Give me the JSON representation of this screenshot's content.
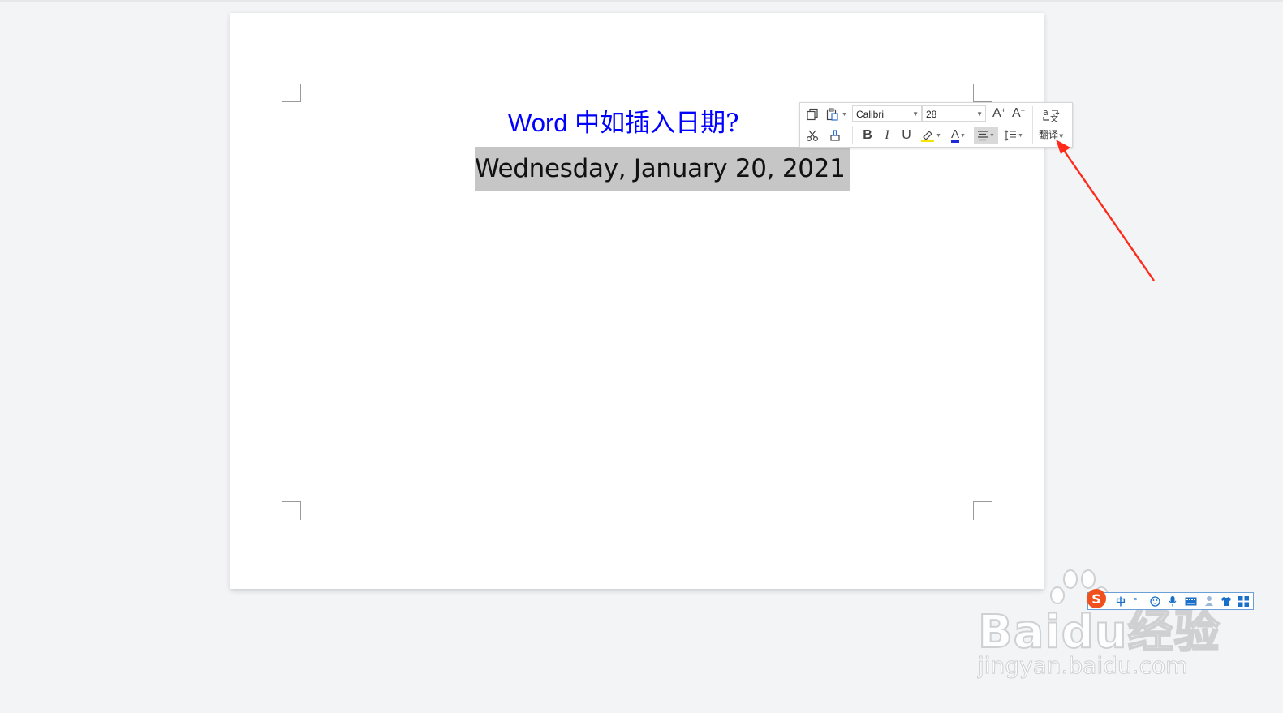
{
  "document": {
    "title_latin": "Word ",
    "title_cjk": "中如插入日期?",
    "date_text": "Wednesday, January 20, 2021"
  },
  "mini_toolbar": {
    "font_name": "Calibri",
    "font_size": "28",
    "grow_font_label": "A",
    "shrink_font_label": "A",
    "bold_label": "B",
    "italic_label": "I",
    "underline_label": "U",
    "font_color_label": "A",
    "translate_label": "翻译",
    "highlight_color": "#f5e600",
    "font_color": "#1f2bd8"
  },
  "ime_bar": {
    "logo_label": "S",
    "mode_label": "中"
  },
  "watermark": {
    "main": "Baidu经验",
    "sub": "jingyan.baidu.com"
  },
  "colors": {
    "title": "#0000ff",
    "selection": "#c6c6c6",
    "annotation_arrow": "#ff2a1a"
  }
}
